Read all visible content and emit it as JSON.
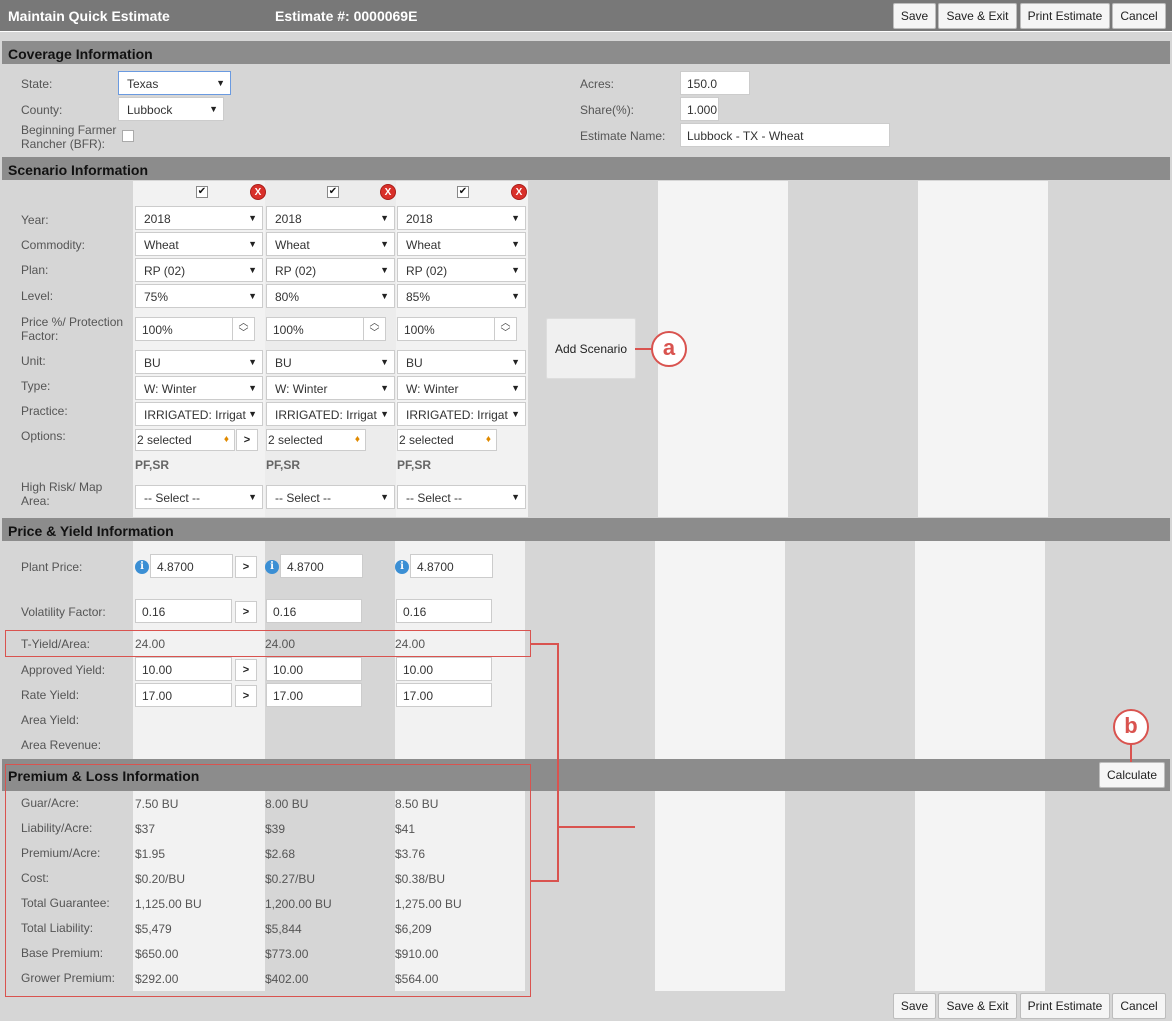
{
  "header": {
    "title": "Maintain Quick Estimate",
    "estimate": "Estimate #: 0000069E"
  },
  "buttons": {
    "save": "Save",
    "save_exit": "Save & Exit",
    "print": "Print Estimate",
    "cancel": "Cancel",
    "add_scenario": "Add Scenario",
    "calculate": "Calculate"
  },
  "coverage": {
    "title": "Coverage Information",
    "state_label": "State:",
    "state": "Texas",
    "county_label": "County:",
    "county": "Lubbock",
    "bfr_label_1": "Beginning Farmer",
    "bfr_label_2": "Rancher (BFR):",
    "acres_label": "Acres:",
    "acres": "150.0",
    "share_label": "Share(%):",
    "share": "1.000",
    "name_label": "Estimate Name:",
    "name": "Lubbock - TX - Wheat"
  },
  "scenario": {
    "title": "Scenario Information",
    "labels": {
      "year": "Year:",
      "commodity": "Commodity:",
      "plan": "Plan:",
      "level": "Level:",
      "price1": "Price %/ Protection",
      "price2": "Factor:",
      "unit": "Unit:",
      "type": "Type:",
      "practice": "Practice:",
      "options": "Options:",
      "hr1": "High Risk/ Map",
      "hr2": "Area:"
    },
    "cols": [
      {
        "year": "2018",
        "commodity": "Wheat",
        "plan": "RP (02)",
        "level": "75%",
        "price": "100%",
        "unit": "BU",
        "type": "W: Winter",
        "practice": "IRRIGATED: Irrigat",
        "options": "2 selected",
        "options_codes": "PF,SR",
        "high_risk": "-- Select --"
      },
      {
        "year": "2018",
        "commodity": "Wheat",
        "plan": "RP (02)",
        "level": "80%",
        "price": "100%",
        "unit": "BU",
        "type": "W: Winter",
        "practice": "IRRIGATED: Irrigat",
        "options": "2 selected",
        "options_codes": "PF,SR",
        "high_risk": "-- Select --"
      },
      {
        "year": "2018",
        "commodity": "Wheat",
        "plan": "RP (02)",
        "level": "85%",
        "price": "100%",
        "unit": "BU",
        "type": "W: Winter",
        "practice": "IRRIGATED: Irrigat",
        "options": "2 selected",
        "options_codes": "PF,SR",
        "high_risk": "-- Select --"
      }
    ]
  },
  "price_yield": {
    "title": "Price & Yield Information",
    "labels": {
      "plant_price": "Plant Price:",
      "volatility": "Volatility Factor:",
      "tyield": "T-Yield/Area:",
      "approved": "Approved Yield:",
      "rate": "Rate Yield:",
      "area_yield": "Area Yield:",
      "area_revenue": "Area Revenue:"
    },
    "cols": [
      {
        "plant_price": "4.8700",
        "volatility": "0.16",
        "tyield": "24.00",
        "approved": "10.00",
        "rate": "17.00"
      },
      {
        "plant_price": "4.8700",
        "volatility": "0.16",
        "tyield": "24.00",
        "approved": "10.00",
        "rate": "17.00"
      },
      {
        "plant_price": "4.8700",
        "volatility": "0.16",
        "tyield": "24.00",
        "approved": "10.00",
        "rate": "17.00"
      }
    ]
  },
  "premium": {
    "title": "Premium & Loss Information",
    "labels": [
      "Guar/Acre:",
      "Liability/Acre:",
      "Premium/Acre:",
      "Cost:",
      "Total Guarantee:",
      "Total Liability:",
      "Base Premium:",
      "Grower Premium:"
    ],
    "cols": [
      [
        "7.50 BU",
        "$37",
        "$1.95",
        "$0.20/BU",
        "1,125.00 BU",
        "$5,479",
        "$650.00",
        "$292.00"
      ],
      [
        "8.00 BU",
        "$39",
        "$2.68",
        "$0.27/BU",
        "1,200.00 BU",
        "$5,844",
        "$773.00",
        "$402.00"
      ],
      [
        "8.50 BU",
        "$41",
        "$3.76",
        "$0.38/BU",
        "1,275.00 BU",
        "$6,209",
        "$910.00",
        "$564.00"
      ]
    ]
  },
  "callouts": {
    "a": "a",
    "b": "b"
  },
  "icons": {
    "checkbox": "checkbox-icon",
    "remove": "remove-icon",
    "info": "info-icon",
    "caret": "chevron-down-icon"
  }
}
